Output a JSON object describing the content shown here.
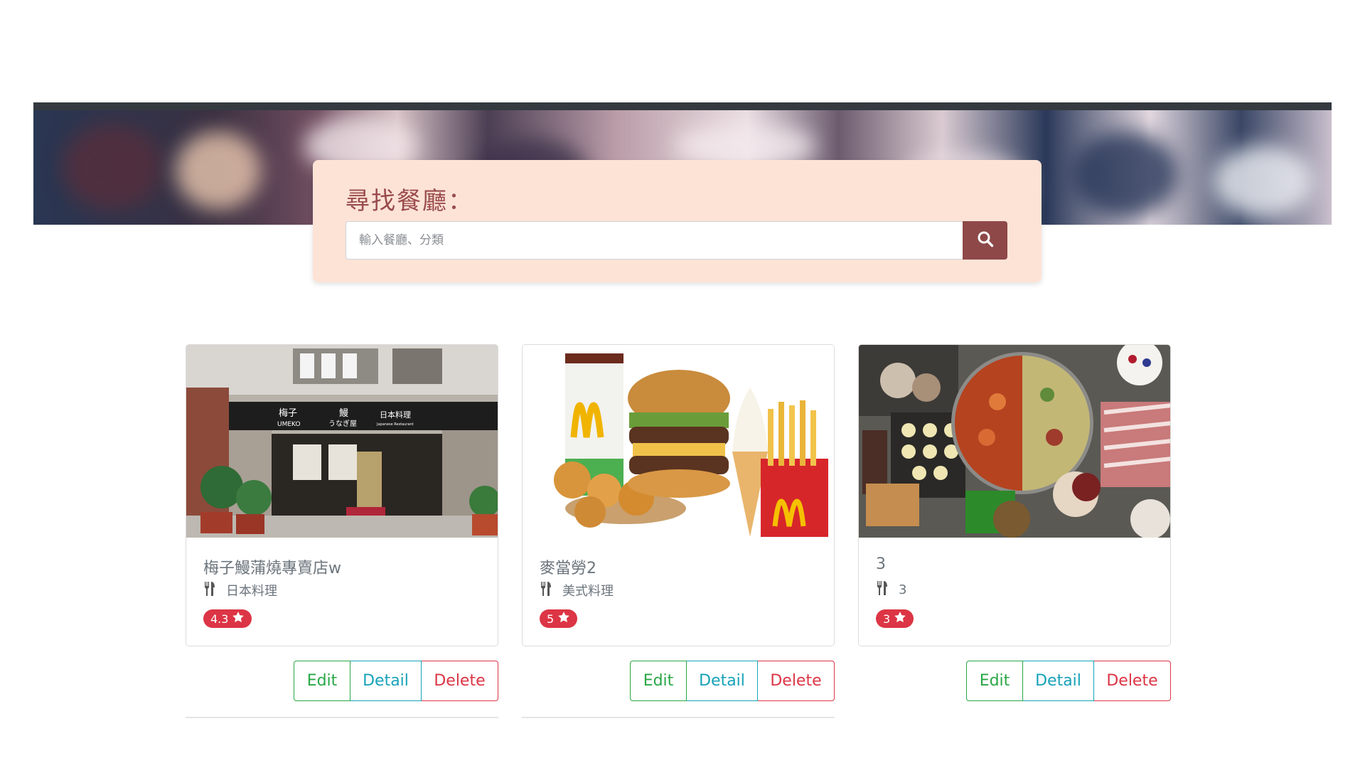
{
  "search": {
    "title": "尋找餐廳：",
    "placeholder": "輸入餐廳、分類"
  },
  "restaurants": [
    {
      "name": "梅子鰻蒲燒專賣店w",
      "category": "日本料理",
      "rating": "4.3"
    },
    {
      "name": "麥當勞2",
      "category": "美式料理",
      "rating": "5"
    },
    {
      "name": "3",
      "category": "3",
      "rating": "3"
    }
  ],
  "actions": {
    "edit": "Edit",
    "detail": "Detail",
    "delete": "Delete"
  },
  "image_labels": {
    "umeko_sign_1": "梅子",
    "umeko_sign_2": "UMEKO",
    "umeko_sign_3": "鰻",
    "umeko_sign_4": "うなぎ屋",
    "umeko_sign_5": "日本料理",
    "umeko_sign_6": "Japanese Restaurant"
  },
  "colors": {
    "search_bg": "#fde3d6",
    "search_button": "#8e4848",
    "badge": "#dc3545",
    "edit": "#28a745",
    "detail": "#17a2b8",
    "delete": "#dc3545"
  }
}
